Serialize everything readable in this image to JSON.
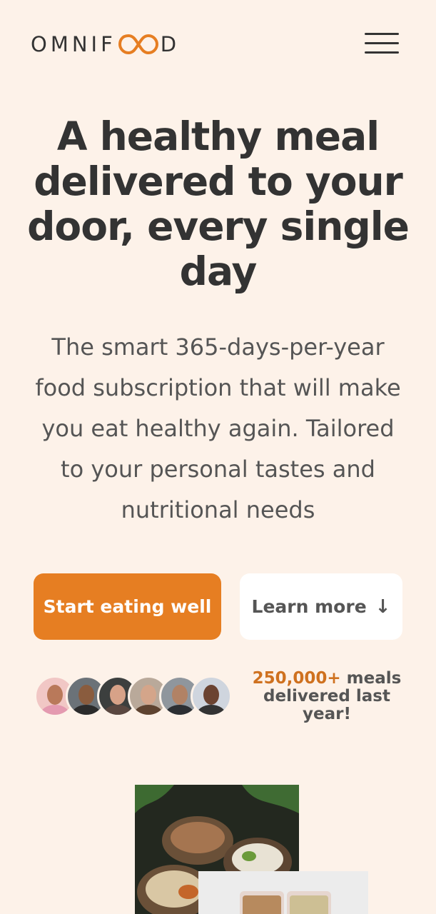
{
  "brand": {
    "name_left": "OMNIF",
    "name_right": "D",
    "accent": "#e67e22"
  },
  "nav": {
    "menu_icon": "hamburger-icon"
  },
  "hero": {
    "title": "A healthy meal delivered to your door, every single day",
    "description": "The smart 365-days-per-year food subscription that will make you eat healthy again. Tailored to your personal tastes and nutritional needs"
  },
  "cta": {
    "primary": "Start eating well",
    "secondary": "Learn more",
    "secondary_icon": "arrow-down-icon"
  },
  "social_proof": {
    "count": "250,000+",
    "text": " meals delivered last year!",
    "avatars": [
      "customer-1",
      "customer-2",
      "customer-3",
      "customer-4",
      "customer-5",
      "customer-6"
    ]
  },
  "colors": {
    "background": "#fdf2e9",
    "primary_button": "#e67e22",
    "text": "#333333"
  }
}
